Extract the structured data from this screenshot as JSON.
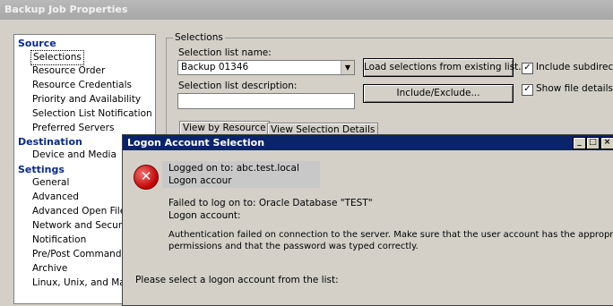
{
  "window": {
    "title": "Backup Job Properties"
  },
  "nav": {
    "sections": [
      {
        "label": "Source",
        "items": [
          "Selections",
          "Resource Order",
          "Resource Credentials",
          "Priority and Availability",
          "Selection List Notification",
          "Preferred Servers"
        ]
      },
      {
        "label": "Destination",
        "items": [
          "Device and Media"
        ]
      },
      {
        "label": "Settings",
        "items": [
          "General",
          "Advanced",
          "Advanced Open File",
          "Network and Security",
          "Notification",
          "Pre/Post Commands",
          "Archive",
          "Linux, Unix, and Maci"
        ]
      }
    ],
    "selected": "Selections"
  },
  "selections": {
    "group_label": "Selections",
    "list_name_label": "Selection list name:",
    "list_name_value": "Backup 01346",
    "description_label": "Selection list description:",
    "description_value": "",
    "load_button": "Load selections from existing list...",
    "include_exclude_button": "Include/Exclude...",
    "include_subdirs": {
      "label": "Include subdirecto",
      "checked": true
    },
    "show_file_details": {
      "label": "Show file details",
      "checked": true
    },
    "tabs": [
      "View by Resource",
      "View Selection Details"
    ]
  },
  "dialog": {
    "title": "Logon Account Selection",
    "logged_on_line": "Logged on to: abc.test.local",
    "logon_account_line": "Logon accour",
    "failed_line": "Failed to log on to: Oracle Database \"TEST\"",
    "logon_account_label": "Logon account:",
    "auth_line1": "Authentication failed on connection to the server. Make sure that the user account has the appropriate",
    "auth_line2": "permissions and that the password was typed correctly.",
    "select_prompt": "Please select a logon account from the list:",
    "caption_buttons": {
      "minimize": "_",
      "maximize": "□",
      "close": "×"
    },
    "error_icon": "error-x-icon"
  },
  "colors": {
    "dialog_title_bg": "#0a246a",
    "section_text": "#0a2a8a",
    "error_red": "#c00000"
  }
}
